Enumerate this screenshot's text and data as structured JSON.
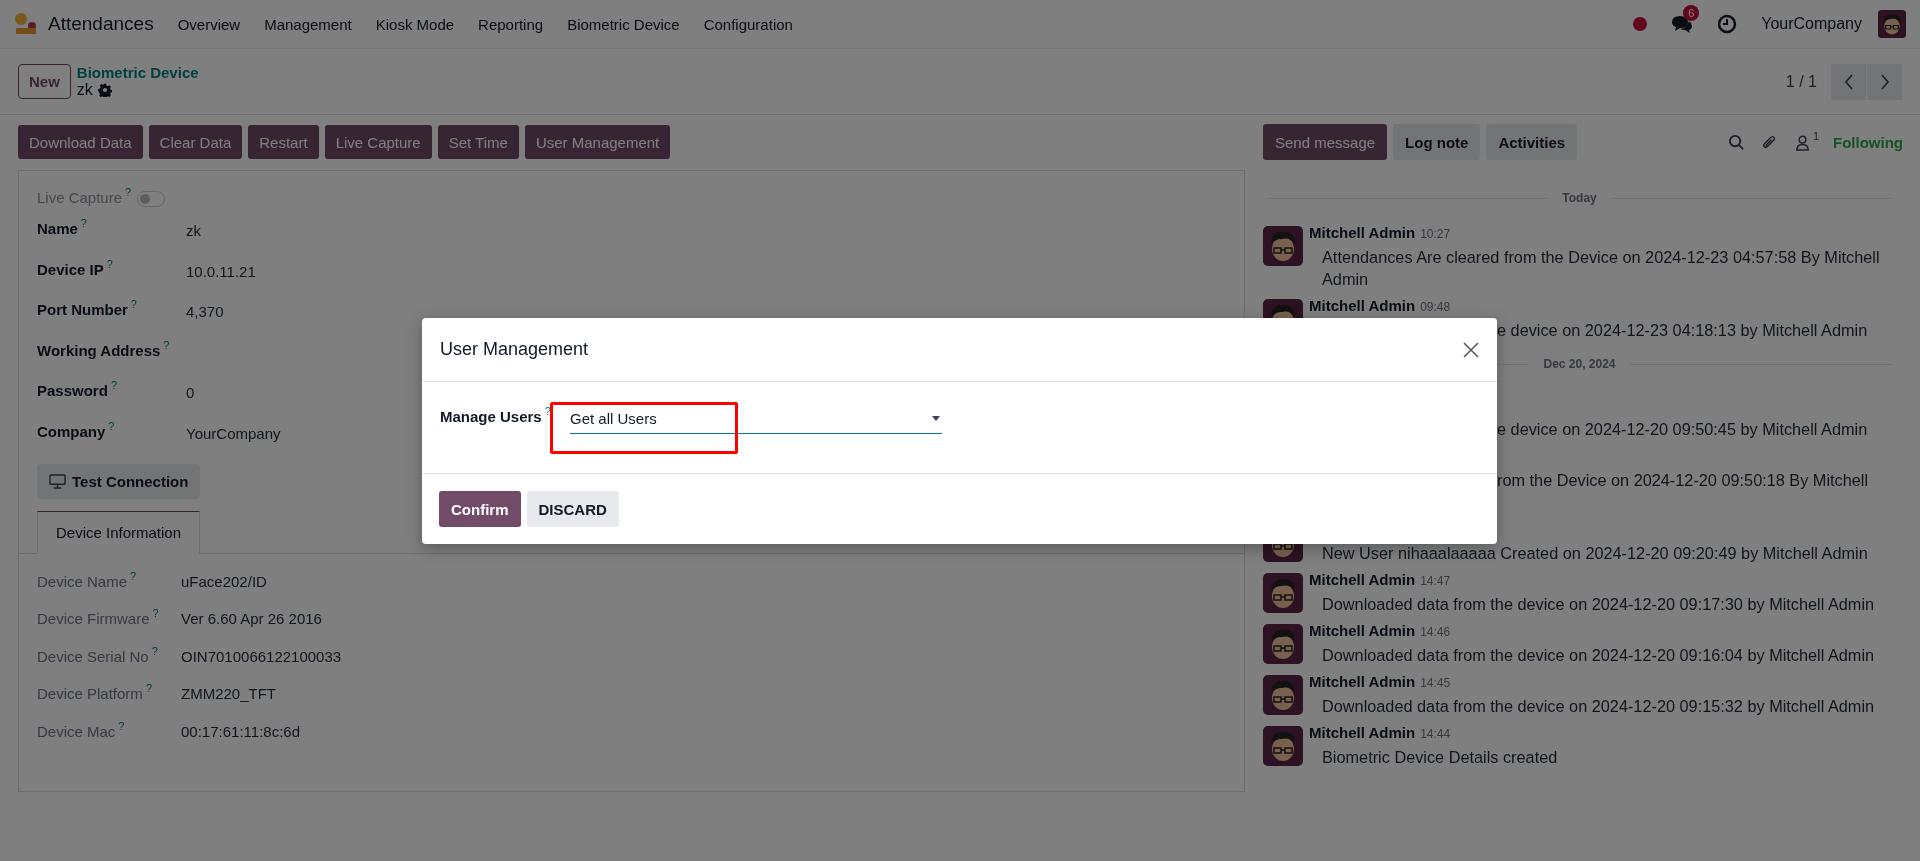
{
  "navbar": {
    "app": "Attendances",
    "menu": [
      "Overview",
      "Management",
      "Kiosk Mode",
      "Reporting",
      "Biometric Device",
      "Configuration"
    ],
    "message_count": "6",
    "company": "YourCompany"
  },
  "control_panel": {
    "new_button": "New",
    "breadcrumb": "Biometric Device",
    "record": "zk",
    "pager": "1 / 1"
  },
  "actions": [
    "Download Data",
    "Clear Data",
    "Restart",
    "Live Capture",
    "Set Time",
    "User Management"
  ],
  "form": {
    "live_capture": {
      "label": "Live Capture",
      "help": "?",
      "on": false
    },
    "fields": [
      {
        "label": "Name",
        "help": "?",
        "value": "zk"
      },
      {
        "label": "Device IP",
        "help": "?",
        "value": "10.0.11.21"
      },
      {
        "label": "Port Number",
        "help": "?",
        "value": "4,370"
      },
      {
        "label": "Working Address",
        "help": "?"
      },
      {
        "label": "Password",
        "help": "?",
        "value": "0"
      },
      {
        "label": "Company",
        "help": "?",
        "value": "YourCompany"
      }
    ],
    "test_button": "Test Connection",
    "tabs": [
      {
        "label": "Device Information",
        "selected": true
      }
    ],
    "info_fields": [
      {
        "label": "Device Name",
        "help": "?",
        "value": "uFace202/ID"
      },
      {
        "label": "Device Firmware",
        "help": "?",
        "value": "Ver 6.60 Apr 26 2016"
      },
      {
        "label": "Device Serial No",
        "help": "?",
        "value": "OIN7010066122100033"
      },
      {
        "label": "Device Platform",
        "help": "?",
        "value": "ZMM220_TFT"
      },
      {
        "label": "Device Mac",
        "help": "?",
        "value": "00:17:61:11:8c:6d"
      }
    ]
  },
  "chatter": {
    "buttons": [
      {
        "label": "Send message",
        "kind": "primary"
      },
      {
        "label": "Log note",
        "kind": "secondary"
      },
      {
        "label": "Activities",
        "kind": "secondary"
      }
    ],
    "followers": "1",
    "follow_status": "Following",
    "groups": [
      {
        "date": "Today",
        "messages": [
          {
            "kind": "full",
            "author": "Mitchell Admin",
            "time": "10:27",
            "text": "Attendances Are cleared from the Device on 2024-12-23 04:57:58 By Mitchell Admin"
          },
          {
            "kind": "head",
            "author": "Mitchell Admin",
            "time": "09:48",
            "text": "e device on 2024-12-23 04:18:13 by Mitchell Admin"
          }
        ]
      },
      {
        "date": "Dec 20, 2024",
        "messages": [
          {
            "kind": "fragment",
            "wrapped": false,
            "text": "e device on 2024-12-20 09:50:45 by Mitchell Admin"
          },
          {
            "kind": "fragment",
            "wrapped": true,
            "text": "rom the Device on 2024-12-20 09:50:18 By Mitchell"
          },
          {
            "kind": "tail",
            "text": "New User nihaaalaaaaa Created on 2024-12-20 09:20:49 by Mitchell Admin"
          },
          {
            "kind": "full",
            "author": "Mitchell Admin",
            "time": "14:47",
            "text": "Downloaded data from the device on 2024-12-20 09:17:30 by Mitchell Admin"
          },
          {
            "kind": "full",
            "author": "Mitchell Admin",
            "time": "14:46",
            "text": "Downloaded data from the device on 2024-12-20 09:16:04 by Mitchell Admin"
          },
          {
            "kind": "full",
            "author": "Mitchell Admin",
            "time": "14:45",
            "text": "Downloaded data from the device on 2024-12-20 09:15:32 by Mitchell Admin"
          },
          {
            "kind": "full",
            "author": "Mitchell Admin",
            "time": "14:44",
            "text": "Biometric Device Details created"
          }
        ]
      }
    ]
  },
  "dialog": {
    "title": "User Management",
    "field": {
      "label": "Manage Users",
      "help": "?",
      "value": "Get all Users",
      "highlighted": true
    },
    "buttons": [
      {
        "label": "Confirm",
        "kind": "primary"
      },
      {
        "label": "DISCARD",
        "kind": "secondary"
      }
    ]
  }
}
